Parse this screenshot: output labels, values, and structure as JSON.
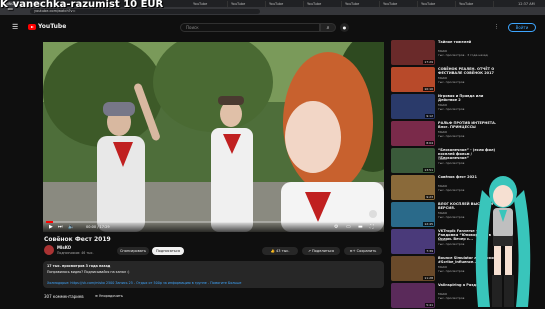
{
  "overlay": {
    "text": "K_vanechka-razumist  10 EUR"
  },
  "browser": {
    "tabs": [
      {
        "label": "CRINGE"
      },
      {
        "label": "YouTube"
      },
      {
        "label": "YouTube"
      },
      {
        "label": "YouTube"
      },
      {
        "label": "YouTube"
      },
      {
        "label": "YouTube"
      },
      {
        "label": "YouTube"
      },
      {
        "label": "YouTube"
      },
      {
        "label": "YouTube"
      }
    ],
    "url": "youtube.com/watch?v=",
    "clock": "12:37 AM"
  },
  "header": {
    "logo": "YouTube",
    "search_placeholder": "Поиск",
    "search_icon": "search-icon",
    "mic_icon": "mic-icon",
    "signin_label": "Войти"
  },
  "player": {
    "time": "00:00 / 17:29",
    "progress": 0.02
  },
  "video": {
    "title": "Совёнок Фест 2019",
    "channel": "MlsKO",
    "subscribers": "Подписчиков: 46 тыс.",
    "subscribe_btn": "Спонсировать",
    "subscribe2_btn": "Подписаться",
    "likes": "43 тыс.",
    "share": "Поделиться",
    "save": "Сохранить"
  },
  "description": {
    "line1": "17 тыс. просмотров  3 года назад",
    "line2": "Понравилось видео? Подписывайся на канал :)",
    "line3": "Холмодорье: https://vk.com/mlsko 2500 Запись 25 - Отдых от 500р за информацию в группе - Помогите Больше"
  },
  "comments": {
    "count": "307 комментариев",
    "sort_label": "Упорядочить"
  },
  "recommended": [
    {
      "title": "Тайное тяжелей",
      "channel": "MlsKO",
      "meta": "тыс. просмотров · 3 года назад",
      "duration": "17:29"
    },
    {
      "title": "СОВЁНОК РЕАЛЕН. ОТЧЁТ О ФЕСТИВАЛЕ СОВЁНОК 2017",
      "channel": "MlsKO",
      "meta": "тыс. просмотров",
      "duration": "10:10"
    },
    {
      "title": "Игровая и Правда или Действие 2",
      "channel": "MlsKO",
      "meta": "тыс. просмотров",
      "duration": "9:12"
    },
    {
      "title": "РАЛЬФ ПРОТИВ ИНТЕРНЕТА. Влог. ПРИНЦЕССЫ",
      "channel": "MlsKO",
      "meta": "тыс. просмотров",
      "duration": "8:04"
    },
    {
      "title": "“Бесконечное” - (если фил) косплей фильм / “Бесконечное”",
      "channel": "MlsKO",
      "meta": "тыс. просмотров",
      "duration": "13:51"
    },
    {
      "title": "Совёнок фест 2021",
      "channel": "MlsKO",
      "meta": "тыс. просмотров",
      "duration": "9:23"
    },
    {
      "title": "ВЛОГ КОСПЛЕЙ ВЫСТАВКИ ВЕРСИЯ.",
      "channel": "MlsKO",
      "meta": "тыс. просмотров",
      "duration": "12:45"
    },
    {
      "title": "VKTropik Fanverse - Рандомка “Юникорнии” в Ослом. Вечер с...",
      "channel": "MlsKO",
      "meta": "тыс. просмотров",
      "duration": "7:39"
    },
    {
      "title": "Bounce Simulator лемурские #Scribe_Influence...",
      "channel": "MlsKO",
      "meta": "тыс. просмотров",
      "duration": "11:28"
    },
    {
      "title": "Valinspiring а Раздел...",
      "channel": "MlsKO",
      "meta": "тыс. просмотров",
      "duration": "5:41"
    }
  ]
}
